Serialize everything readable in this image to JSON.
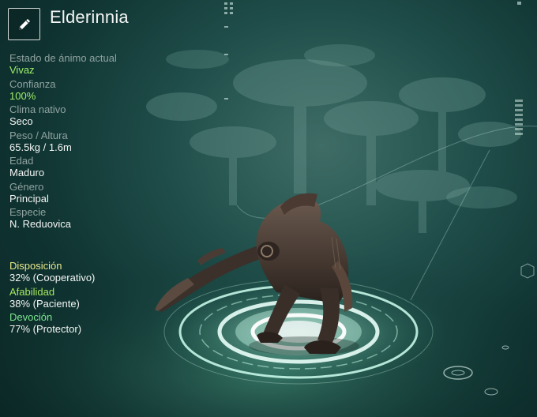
{
  "creature": {
    "name": "Elderinnia"
  },
  "stats": [
    {
      "label": "Estado de ánimo actual",
      "value": "Vivaz",
      "highlight": true
    },
    {
      "label": "Confianza",
      "value": "100%",
      "highlight": true
    },
    {
      "label": "Clima nativo",
      "value": "Seco",
      "highlight": false
    },
    {
      "label": "Peso / Altura",
      "value": "65.5kg / 1.6m",
      "highlight": false
    },
    {
      "label": "Edad",
      "value": "Maduro",
      "highlight": false
    },
    {
      "label": "Género",
      "value": "Principal",
      "highlight": false
    },
    {
      "label": "Especie",
      "value": "N. Reduovica",
      "highlight": false
    }
  ],
  "traits": [
    {
      "label": "Disposición",
      "value": "32% (Cooperativo)",
      "color": "#e9e98a"
    },
    {
      "label": "Afabilidad",
      "value": "38% (Paciente)",
      "color": "#a6e75f"
    },
    {
      "label": "Devoción",
      "value": "77% (Protector)",
      "color": "#7de58f"
    }
  ],
  "icons": {
    "edit": "pencil-icon"
  },
  "colors": {
    "accent_green": "#9ff06a",
    "platform_glow": "#bfffe6"
  }
}
